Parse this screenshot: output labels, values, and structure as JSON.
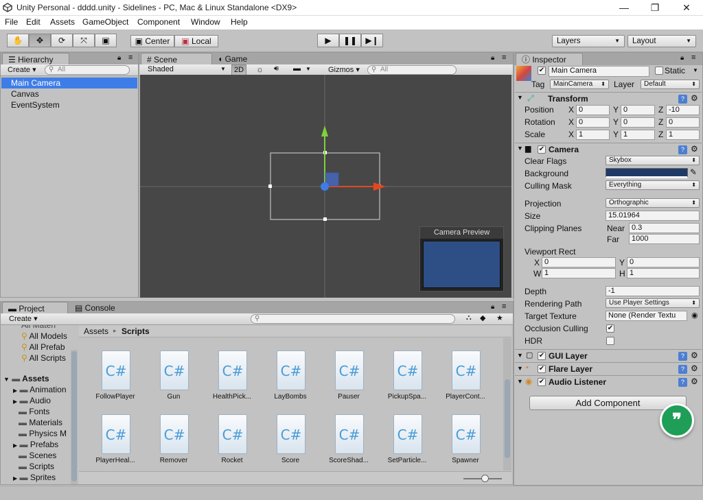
{
  "window": {
    "title": "Unity Personal - dddd.unity - Sidelines - PC, Mac & Linux Standalone <DX9>"
  },
  "menu": [
    "File",
    "Edit",
    "Assets",
    "GameObject",
    "Component",
    "Window",
    "Help"
  ],
  "toolbar": {
    "pivot": "Center",
    "space": "Local",
    "layers": "Layers",
    "layout": "Layout"
  },
  "hierarchy": {
    "tab": "Hierarchy",
    "create": "Create",
    "search_placeholder": "All",
    "items": [
      "Main Camera",
      "Canvas",
      "EventSystem"
    ],
    "selected": 0
  },
  "scene": {
    "tabs": [
      "Scene",
      "Game"
    ],
    "shading": "Shaded",
    "mode2d": "2D",
    "gizmos": "Gizmos",
    "search_placeholder": "All",
    "camera_preview_title": "Camera Preview",
    "colors": {
      "background": "#474747",
      "preview": "#2e4f86",
      "x_axis": "#e2491f",
      "y_axis": "#7fd23a",
      "selection": "#3e7de7"
    }
  },
  "project": {
    "tabs": [
      "Project",
      "Console"
    ],
    "create": "Create",
    "tree": {
      "favorites_cut": "All Materi",
      "favorites": [
        "All Models",
        "All Prefab",
        "All Scripts"
      ],
      "assets_root": "Assets",
      "folders": [
        "Animation",
        "Audio",
        "Fonts",
        "Materials",
        "Physics M",
        "Prefabs",
        "Scenes",
        "Scripts",
        "Sprites"
      ]
    },
    "breadcrumb": [
      "Assets",
      "Scripts"
    ],
    "files": [
      "FollowPlayer",
      "Gun",
      "HealthPick...",
      "LayBombs",
      "Pauser",
      "PickupSpa...",
      "PlayerCont...",
      "PlayerHeal...",
      "Remover",
      "Rocket",
      "Score",
      "ScoreShad...",
      "SetParticle...",
      "Spawner"
    ],
    "file_icon_text": "C#"
  },
  "inspector": {
    "tab": "Inspector",
    "object_name": "Main Camera",
    "static_label": "Static",
    "tag_label": "Tag",
    "tag_value": "MainCamera",
    "layer_label": "Layer",
    "layer_value": "Default",
    "transform": {
      "title": "Transform",
      "position": [
        "0",
        "0",
        "-10"
      ],
      "rotation": [
        "0",
        "0",
        "0"
      ],
      "scale": [
        "1",
        "1",
        "1"
      ],
      "labels": [
        "Position",
        "Rotation",
        "Scale"
      ],
      "axes": [
        "X",
        "Y",
        "Z"
      ]
    },
    "camera": {
      "title": "Camera",
      "clear_flags_label": "Clear Flags",
      "clear_flags": "Skybox",
      "background_label": "Background",
      "background_color": "#1f3a66",
      "culling_mask_label": "Culling Mask",
      "culling_mask": "Everything",
      "projection_label": "Projection",
      "projection": "Orthographic",
      "size_label": "Size",
      "size": "15.01964",
      "clipping_label": "Clipping Planes",
      "near_label": "Near",
      "near": "0.3",
      "far_label": "Far",
      "far": "1000",
      "viewport_label": "Viewport Rect",
      "vx": "0",
      "vy": "0",
      "vw": "1",
      "vh": "1",
      "depth_label": "Depth",
      "depth": "-1",
      "render_path_label": "Rendering Path",
      "render_path": "Use Player Settings",
      "target_texture_label": "Target Texture",
      "target_texture": "None (Render Textu",
      "occlusion_label": "Occlusion Culling",
      "hdr_label": "HDR"
    },
    "components": [
      "GUI Layer",
      "Flare Layer",
      "Audio Listener"
    ],
    "add_component": "Add Component"
  }
}
